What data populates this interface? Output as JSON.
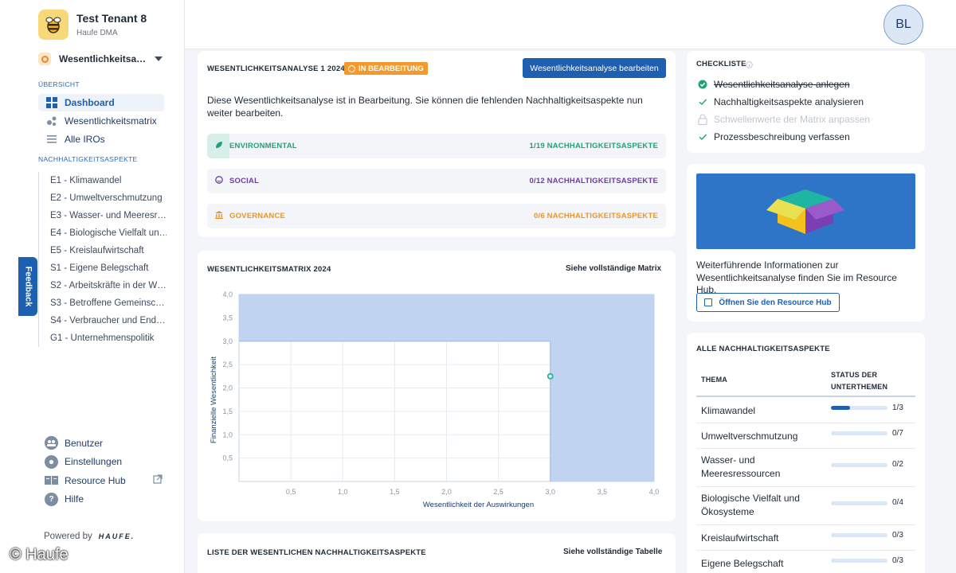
{
  "tenant": {
    "name": "Test Tenant 8",
    "sub": "Haufe DMA"
  },
  "analysis_select": {
    "label": "Wesentlichkeitsa…"
  },
  "sidebar": {
    "overview_label": "ÜBERSICHT",
    "nav": [
      {
        "label": "Dashboard",
        "icon": "dashboard-icon",
        "active": true
      },
      {
        "label": "Wesentlichkeitsmatrix",
        "icon": "matrix-icon"
      },
      {
        "label": "Alle IROs",
        "icon": "list-icon"
      }
    ],
    "aspects_label": "NACHHALTIGKEITSASPEKTE",
    "aspects": [
      "E1 - Klimawandel",
      "E2 - Umweltverschmutzung",
      "E3 - Wasser- und Meeresr…",
      "E4 - Biologische Vielfalt un…",
      "E5 - Kreislaufwirtschaft",
      "S1 - Eigene Belegschaft",
      "S2 - Arbeitskräfte in der W…",
      "S3 - Betroffene Gemeinsc…",
      "S4 - Verbraucher und End…",
      "G1 - Unternehmenspolitik"
    ],
    "bottom_nav": [
      {
        "label": "Benutzer",
        "icon": "users-icon"
      },
      {
        "label": "Einstellungen",
        "icon": "gear-icon"
      },
      {
        "label": "Resource Hub",
        "icon": "book-icon"
      },
      {
        "label": "Hilfe",
        "icon": "help-icon"
      }
    ],
    "powered_by": "Powered by",
    "powered_brand": "HAUFE.",
    "feedback": "Feedback"
  },
  "watermark": "© Haufe",
  "user": {
    "initials": "BL"
  },
  "analysis_card": {
    "title": "WESENTLICHKEITSANALYSE 1 2024",
    "status": "IN BEARBEITUNG",
    "edit_button": "Wesentlichkeitsanalyse bearbeiten",
    "description": "Diese Wesentlichkeitsanalyse ist in Bearbeitung. Sie können die fehlenden Nachhaltigkeitsaspekte nun weiter bearbeiten.",
    "categories": [
      {
        "name": "ENVIRONMENTAL",
        "count": "1/19 NACHHALTIGKEITSASPEKTE",
        "color": "#22a07b"
      },
      {
        "name": "SOCIAL",
        "count": "0/12 NACHHALTIGKEITSASPEKTE",
        "color": "#6b3fa0"
      },
      {
        "name": "GOVERNANCE",
        "count": "0/6 NACHHALTIGKEITSASPEKTE",
        "color": "#e8962a"
      }
    ]
  },
  "matrix_card": {
    "title": "WESENTLICHKEITSMATRIX 2024",
    "link": "Siehe vollständige Matrix"
  },
  "chart_data": {
    "type": "scatter",
    "title": "WESENTLICHKEITSMATRIX 2024",
    "xlabel": "Wesentlichkeit der Auswirkungen",
    "ylabel": "Finanzielle Wesentlichkeit",
    "xlim": [
      0,
      4.0
    ],
    "ylim": [
      0,
      4.0
    ],
    "x_ticks": [
      "0,5",
      "1,0",
      "1,5",
      "2,0",
      "2,5",
      "3,0",
      "3,5",
      "4,0"
    ],
    "y_ticks": [
      "0,5",
      "1,0",
      "1,5",
      "2,0",
      "2,5",
      "3,0",
      "3,5",
      "4,0"
    ],
    "threshold_x": 3.0,
    "threshold_y": 3.0,
    "points": [
      {
        "x": 3.0,
        "y": 2.25
      }
    ],
    "region_color": "#b9cff0",
    "point_color": "#1fb5a3",
    "grid": true
  },
  "list_card": {
    "title": "LISTE DER WESENTLICHEN NACHHALTIGKEITSASPEKTE",
    "link": "Siehe vollständige Tabelle"
  },
  "checklist": {
    "title": "CHECKLISTE",
    "items": [
      {
        "label": "Wesentlichkeitsanalyse anlegen",
        "state": "done"
      },
      {
        "label": "Nachhaltigkeitsaspekte analysieren",
        "state": "check"
      },
      {
        "label": "Schwellenwerte der Matrix anpassen",
        "state": "locked"
      },
      {
        "label": "Prozessbeschreibung verfassen",
        "state": "check"
      }
    ]
  },
  "resource_hub": {
    "text": "Weiterführende Informationen zur Wesentlichkeitsanalyse finden Sie im Resource Hub.",
    "button": "Öffnen Sie den Resource Hub"
  },
  "aspects_table": {
    "title": "ALLE NACHHALTIGKEITSASPEKTE",
    "col_theme": "THEMA",
    "col_status": "STATUS DER UNTERTHEMEN",
    "rows": [
      {
        "name": "Klimawandel",
        "count": "1/3",
        "progress": 0.333
      },
      {
        "name": "Umweltverschmutzung",
        "count": "0/7",
        "progress": 0
      },
      {
        "name": "Wasser- und Meeresressourcen",
        "count": "0/2",
        "progress": 0
      },
      {
        "name": "Biologische Vielfalt und Ökosysteme",
        "count": "0/4",
        "progress": 0
      },
      {
        "name": "Kreislaufwirtschaft",
        "count": "0/3",
        "progress": 0
      },
      {
        "name": "Eigene Belegschaft",
        "count": "0/3",
        "progress": 0
      }
    ]
  }
}
